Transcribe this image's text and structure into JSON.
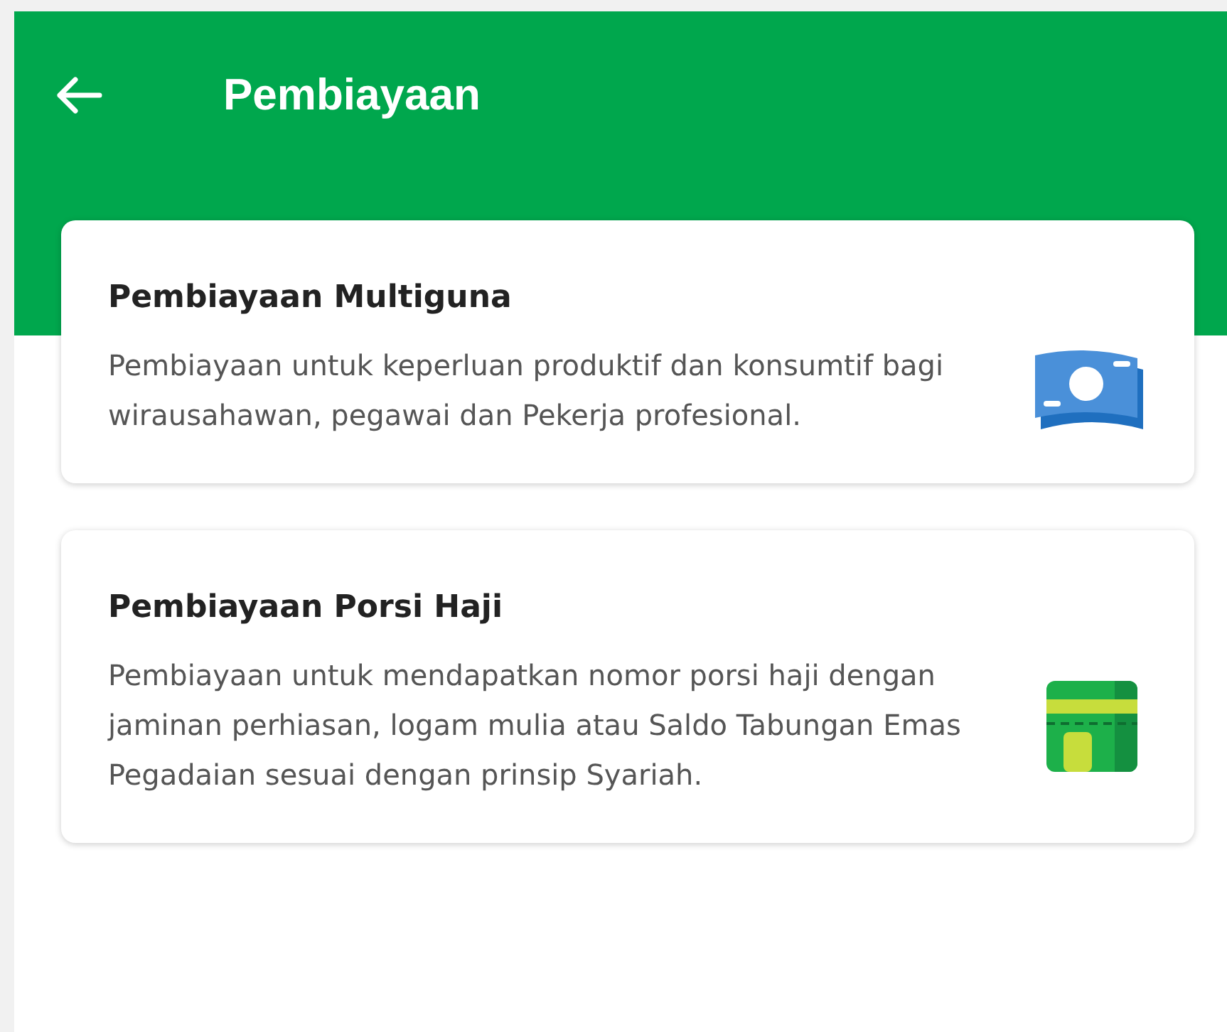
{
  "header": {
    "title": "Pembiayaan"
  },
  "cards": [
    {
      "title": "Pembiayaan Multiguna",
      "description": "Pembiayaan untuk keperluan produktif dan konsumtif bagi wirausahawan, pegawai dan Pekerja profesional.",
      "kind": "money"
    },
    {
      "title": "Pembiayaan Porsi Haji",
      "description": "Pembiayaan untuk mendapatkan nomor porsi haji dengan jaminan perhiasan, logam mulia atau Saldo Tabungan Emas Pegadaian sesuai dengan prinsip Syariah.",
      "kind": "kaaba"
    }
  ]
}
